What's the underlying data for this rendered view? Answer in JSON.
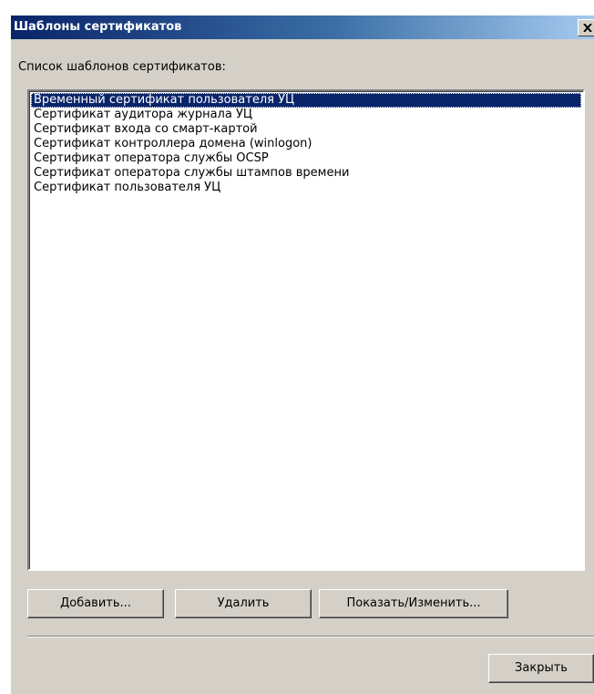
{
  "window": {
    "title": "Шаблоны сертификатов"
  },
  "list": {
    "label": "Список шаблонов сертификатов:",
    "items": [
      "Временный сертификат пользователя УЦ",
      "Сертификат аудитора журнала УЦ",
      "Сертификат входа со смарт-картой",
      "Сертификат контроллера домена (winlogon)",
      "Сертификат оператора службы OCSP",
      "Сертификат оператора службы штампов времени",
      "Сертификат пользователя УЦ"
    ],
    "selected_index": 0
  },
  "buttons": {
    "add": "Добавить...",
    "delete": "Удалить",
    "view_edit": "Показать/Изменить...",
    "close": "Закрыть"
  },
  "icons": {
    "close": "close-icon"
  },
  "colors": {
    "title_bar_start": "#0a246a",
    "title_bar_end": "#a6caf0",
    "dialog_bg": "#d4d0c8",
    "selection": "#0a246a"
  }
}
